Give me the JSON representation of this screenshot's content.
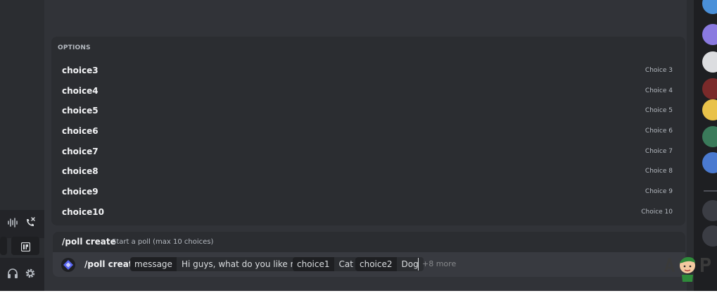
{
  "options_panel": {
    "header": "OPTIONS",
    "items": [
      {
        "name": "choice3",
        "desc": "Choice 3"
      },
      {
        "name": "choice4",
        "desc": "Choice 4"
      },
      {
        "name": "choice5",
        "desc": "Choice 5"
      },
      {
        "name": "choice6",
        "desc": "Choice 6"
      },
      {
        "name": "choice7",
        "desc": "Choice 7"
      },
      {
        "name": "choice8",
        "desc": "Choice 8"
      },
      {
        "name": "choice9",
        "desc": "Choice 9"
      },
      {
        "name": "choice10",
        "desc": "Choice 10"
      }
    ]
  },
  "command_info": {
    "name": "/poll create",
    "description": "Start a poll (max 10 choices)"
  },
  "chat_input": {
    "command": "/poll create",
    "params": [
      {
        "name": "message",
        "value": "Hi guys, what do you like more"
      },
      {
        "name": "choice1",
        "value": "Cat"
      },
      {
        "name": "choice2",
        "value": "Dog"
      }
    ],
    "more_text": "+8 more"
  },
  "colors": {
    "background": "#313338",
    "panel": "#2b2d31",
    "input": "#383a40",
    "text": "#f2f3f5",
    "muted": "#b5bac1",
    "accent": "#5865f2"
  },
  "icons": {
    "voice_bar": [
      "soundboard-icon",
      "disconnect-call-icon"
    ],
    "user_bar": [
      "headphones-icon",
      "gear-icon"
    ],
    "bot": "bot-avatar-icon"
  }
}
